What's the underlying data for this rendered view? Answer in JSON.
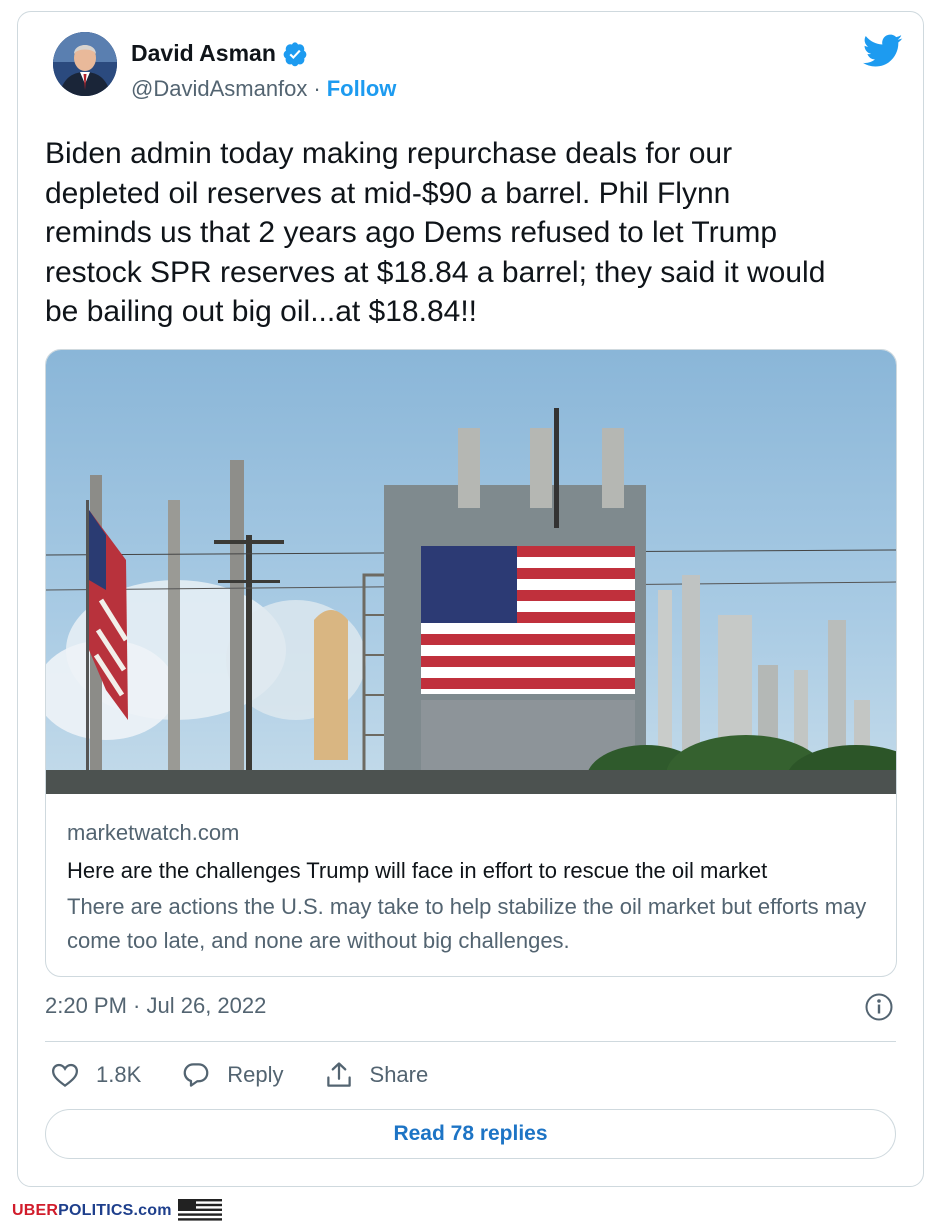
{
  "author": {
    "name": "David Asman",
    "handle": "@DavidAsmanfox",
    "separator": "·",
    "follow_label": "Follow"
  },
  "tweet": {
    "text": "Biden admin today making repurchase deals for our\ndepleted oil reserves at mid-$90 a barrel. Phil Flynn\nreminds us that 2 years ago Dems refused to let Trump\nrestock SPR reserves at $18.84 a barrel; they said it would\nbe bailing out big oil...at $18.84!!",
    "timestamp": "2:20 PM · Jul 26, 2022"
  },
  "link_card": {
    "domain": "marketwatch.com",
    "title": "Here are the challenges Trump will face in effort to rescue the oil market",
    "description": "There are actions the U.S. may take to help stabilize the oil market but efforts may come too late, and none are without big challenges."
  },
  "actions": {
    "like_count": "1.8K",
    "reply_label": "Reply",
    "share_label": "Share"
  },
  "read_replies_label": "Read 78 replies",
  "watermark": {
    "brand_part1": "UBER",
    "brand_part2": "POLITICS.com"
  },
  "colors": {
    "accent": "#1d9bf0",
    "link_button": "#1d74c5",
    "secondary_text": "#536471",
    "border": "#cfd9de"
  },
  "icons": [
    "verified-badge-icon",
    "twitter-bird-icon",
    "info-icon",
    "heart-icon",
    "reply-icon",
    "share-icon",
    "american-flag-icon"
  ]
}
